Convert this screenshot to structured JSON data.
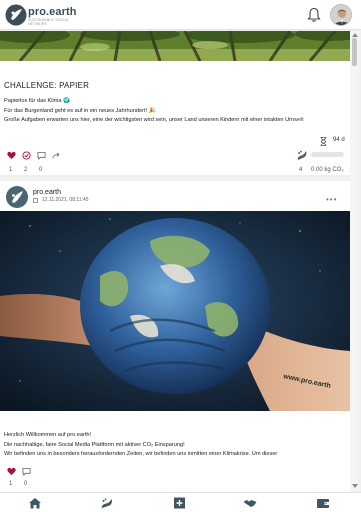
{
  "header": {
    "brand": "pro.earth",
    "brand_tagline": "SUSTAINABLE SOCIAL NETWORK",
    "icons": [
      "bell-icon",
      "user-avatar"
    ]
  },
  "post1": {
    "title": "CHALLENGE: PAPIER",
    "lines": [
      "Papierlos für das Klima 🌍",
      "Für das Burgenland geht es auf in ein neues Jahrhundert! 🎉",
      "Große Aufgaben erwarten uns hier, eine der wichtigsten wird sein, unser Land unseren Kindern mit einer intakten Umwelt"
    ],
    "remaining": "94 d",
    "actions": {
      "likes": "1",
      "challenge_accepts": "2",
      "comments": "0"
    },
    "co2": {
      "count": "4",
      "value": "0.00 kg CO₂"
    }
  },
  "post2": {
    "author": "pro.earth",
    "date": "12.11.2021, 08:11:45",
    "image_watermark": "www.pro.earth",
    "lines": [
      "Herzlich Willkommen auf pro.earth!",
      "Die nachhaltige, faire Social Media Plattform mit aktiver CO₂ Einsparung!",
      "Wir befinden uns in besonders herausfordernden Zeiten, wir befinden uns inmitten einer Klimakrise. Um dieser"
    ],
    "actions": {
      "likes": "1",
      "comments": "0"
    }
  },
  "bottom_nav": [
    "home-icon",
    "footprint-icon",
    "add-post-icon",
    "handshake-icon",
    "wallet-icon"
  ],
  "colors": {
    "brand": "#3c4e57",
    "like": "#a3123a",
    "green": "#4a8a3a"
  }
}
